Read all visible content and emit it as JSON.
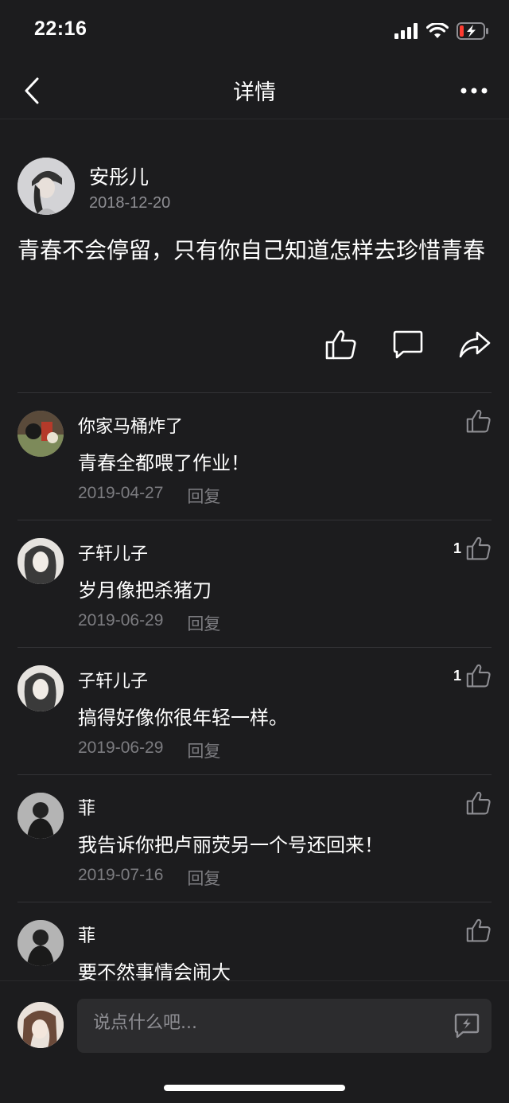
{
  "status_bar": {
    "time": "22:16"
  },
  "nav": {
    "title": "详情"
  },
  "post": {
    "author": "安彤儿",
    "date": "2018-12-20",
    "text": "青春不会停留，只有你自己知道怎样去珍惜青春"
  },
  "comments": [
    {
      "name": "你家马桶炸了",
      "text": "青春全都喂了作业！",
      "date": "2019-04-27",
      "reply": "回复",
      "likes": ""
    },
    {
      "name": "子轩儿子",
      "text": "岁月像把杀猪刀",
      "date": "2019-06-29",
      "reply": "回复",
      "likes": "1"
    },
    {
      "name": "子轩儿子",
      "text": "搞得好像你很年轻一样。",
      "date": "2019-06-29",
      "reply": "回复",
      "likes": "1"
    },
    {
      "name": "菲",
      "text": "我告诉你把卢丽荧另一个号还回来！",
      "date": "2019-07-16",
      "reply": "回复",
      "likes": ""
    },
    {
      "name": "菲",
      "text": "要不然事情会闹大",
      "date": "",
      "reply": "",
      "likes": ""
    }
  ],
  "input": {
    "placeholder": "说点什么吧..."
  },
  "colors": {
    "background": "#1c1c1e",
    "battery_low": "#ff3b30",
    "muted": "#8e8e93"
  }
}
